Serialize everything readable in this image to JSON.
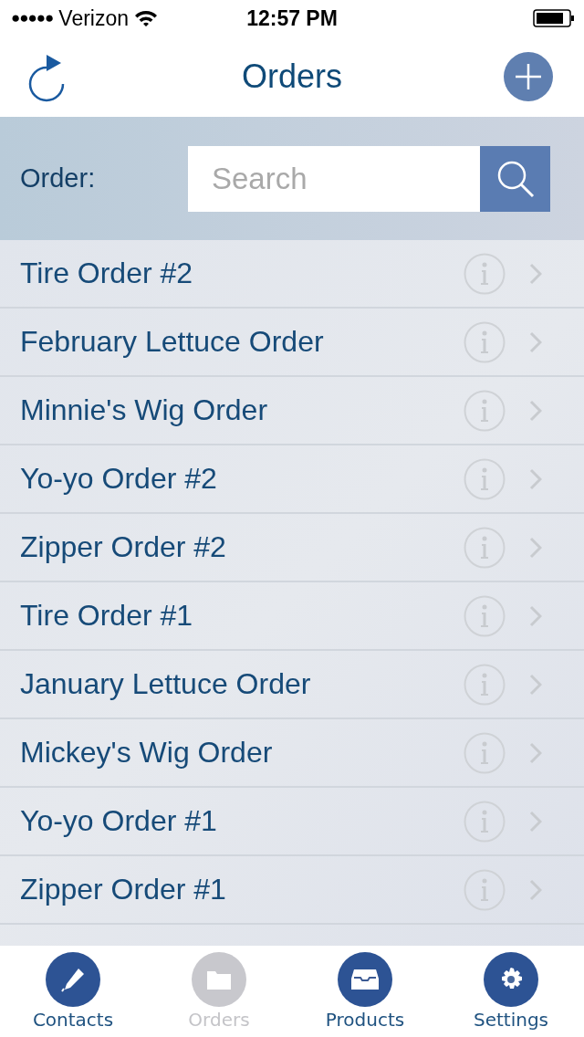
{
  "status_bar": {
    "signal_dots": "●●●●●",
    "carrier": "Verizon",
    "time": "12:57 PM"
  },
  "nav": {
    "title": "Orders"
  },
  "search": {
    "label": "Order:",
    "placeholder": "Search"
  },
  "orders": [
    {
      "name": "Tire Order #2"
    },
    {
      "name": "February Lettuce Order"
    },
    {
      "name": "Minnie's Wig Order"
    },
    {
      "name": "Yo-yo Order #2"
    },
    {
      "name": "Zipper Order #2"
    },
    {
      "name": "Tire Order #1"
    },
    {
      "name": "January Lettuce Order"
    },
    {
      "name": "Mickey's Wig Order"
    },
    {
      "name": "Yo-yo Order #1"
    },
    {
      "name": "Zipper Order #1"
    }
  ],
  "tabs": [
    {
      "label": "Contacts",
      "kind": "pencil",
      "selected": false
    },
    {
      "label": "Orders",
      "kind": "folder",
      "selected": true
    },
    {
      "label": "Products",
      "kind": "inbox",
      "selected": false
    },
    {
      "label": "Settings",
      "kind": "gear",
      "selected": false
    }
  ]
}
